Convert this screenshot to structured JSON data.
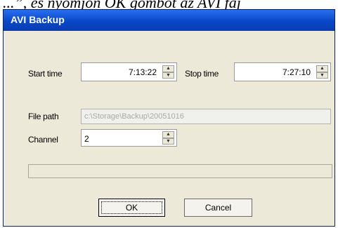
{
  "background_text": "...”, és nyomjon OK gombot az AVI fáj",
  "window": {
    "title": "AVI Backup"
  },
  "start_time": {
    "label": "Start time",
    "value": "7:13:22"
  },
  "stop_time": {
    "label": "Stop time",
    "value": "7:27:10"
  },
  "file_path": {
    "label": "File path",
    "value": "c:\\Storage\\Backup\\20051016"
  },
  "channel": {
    "label": "Channel",
    "value": "2"
  },
  "progress": {
    "fraction": 0
  },
  "buttons": {
    "ok": "OK",
    "cancel": "Cancel"
  },
  "icons": {
    "spin_up": "▲",
    "spin_down": "▼"
  },
  "colors": {
    "titlebar": "#0848c8",
    "dialog_bg": "#ece9d8"
  }
}
